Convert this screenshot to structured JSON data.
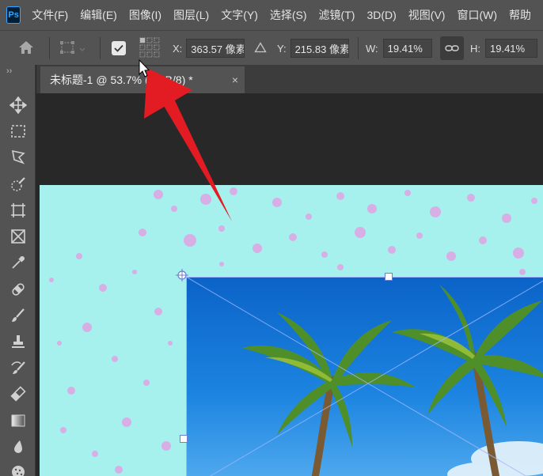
{
  "app": {
    "logo_text": "Ps"
  },
  "menu": [
    "文件(F)",
    "编辑(E)",
    "图像(I)",
    "图层(L)",
    "文字(Y)",
    "选择(S)",
    "滤镜(T)",
    "3D(D)",
    "视图(V)",
    "窗口(W)",
    "帮助"
  ],
  "options": {
    "x_label": "X:",
    "x_value": "363.57 像素",
    "y_label": "Y:",
    "y_value": "215.83 像素",
    "w_label": "W:",
    "w_value": "19.41%",
    "h_label": "H:",
    "h_value": "19.41%"
  },
  "toolbar": {
    "collapse_label": "››"
  },
  "tab": {
    "title": "未标题-1 @ 53.7% (RGB/8) *",
    "close_glyph": "×"
  },
  "colors": {
    "canvas_background": "#a6f0ee",
    "speckle": "#e0a4e4",
    "annotation_arrow": "#e31c23",
    "sky": "#1c84e0"
  }
}
